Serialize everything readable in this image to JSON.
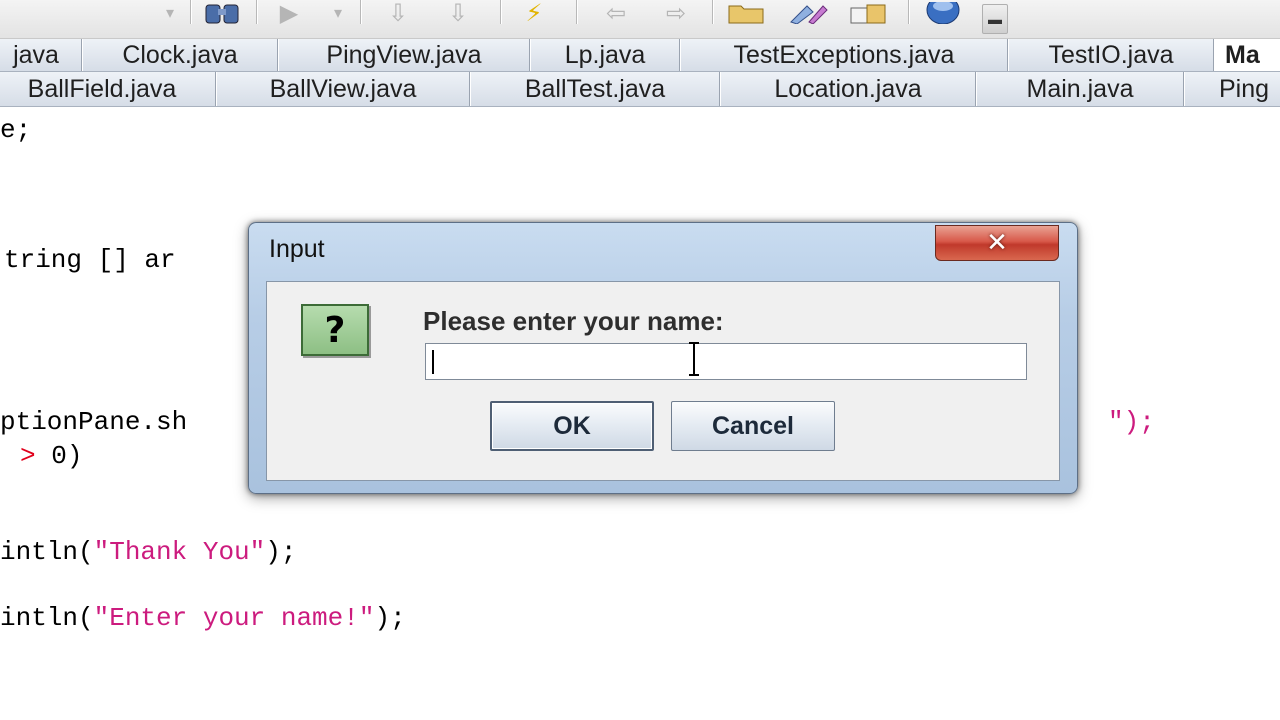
{
  "colors": {
    "dialog_frame": "#b7cde6",
    "close_button": "#c0392b",
    "question_icon": "#8dbf84",
    "string_literal": "#cc1b7e",
    "operator": "#e0001b"
  },
  "toolbar": {
    "icons": [
      "dropdown-icon",
      "find-icon",
      "run-icon",
      "run-dropdown-icon",
      "step-down-icon",
      "step-over-icon",
      "wizard-icon",
      "back-icon",
      "forward-icon",
      "open-folder-icon",
      "tools-icon",
      "package-icon",
      "help-icon",
      "overflow-icon"
    ]
  },
  "tabs": {
    "row1": [
      "java",
      "Clock.java",
      "PingView.java",
      "Lp.java",
      "TestExceptions.java",
      "TestIO.java",
      "Ma"
    ],
    "row2": [
      "BallField.java",
      "BallView.java",
      "BallTest.java",
      "Location.java",
      "Main.java",
      "Ping"
    ],
    "active": "Ma"
  },
  "code": {
    "line1": "e;",
    "line2_pre": "tring [] ar",
    "line3": "ptionPane.sh",
    "line3_tail": "\");",
    "line4_op": ">",
    "line4_rest": "0)",
    "line5_pre": "intln(",
    "line5_str": "\"Thank You\"",
    "line5_post": ");",
    "line6_pre": "intln(",
    "line6_str": "\"Enter your name!\"",
    "line6_post": ");"
  },
  "dialog": {
    "title": "Input",
    "close_symbol": "✕",
    "icon_symbol": "?",
    "prompt": "Please enter your name:",
    "input_value": "",
    "ok_label": "OK",
    "cancel_label": "Cancel"
  }
}
